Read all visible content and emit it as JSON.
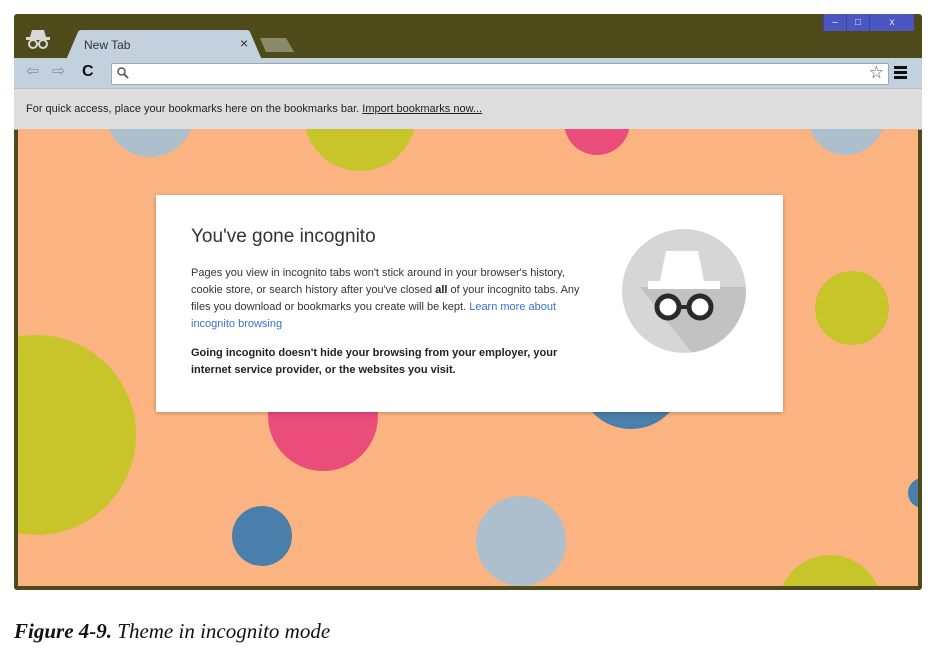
{
  "window": {
    "controls": {
      "minimize": "–",
      "maximize": "□",
      "close": "x"
    }
  },
  "tab": {
    "title": "New Tab",
    "close_glyph": "×"
  },
  "toolbar": {
    "back_glyph": "⇦",
    "forward_glyph": "⇨",
    "reload_glyph": "C",
    "omnibox": {
      "value": "",
      "placeholder": ""
    },
    "star_glyph": "☆"
  },
  "bookmarks_bar": {
    "message": "For quick access, place your bookmarks here on the bookmarks bar.",
    "link": "Import bookmarks now..."
  },
  "incognito": {
    "title": "You've gone incognito",
    "p1_before": "Pages you view in incognito tabs won't stick around in your browser's history, cookie store, or search history after you've closed ",
    "p1_bold": "all",
    "p1_after": " of your incognito tabs. Any files you download or bookmarks you create will be kept. ",
    "learn_more": "Learn more about incognito browsing",
    "warning": "Going incognito doesn't hide your browsing from your employer, your internet service provider, or the websites you visit."
  },
  "theme_colors": {
    "background": "#fbb481",
    "dot_lime": "#c7c52a",
    "dot_pink": "#ea4d79",
    "dot_blue": "#4a7fab",
    "dot_grey": "#adbfcc"
  },
  "caption": {
    "label": "Figure 4-9.",
    "text": "Theme in incognito mode"
  }
}
